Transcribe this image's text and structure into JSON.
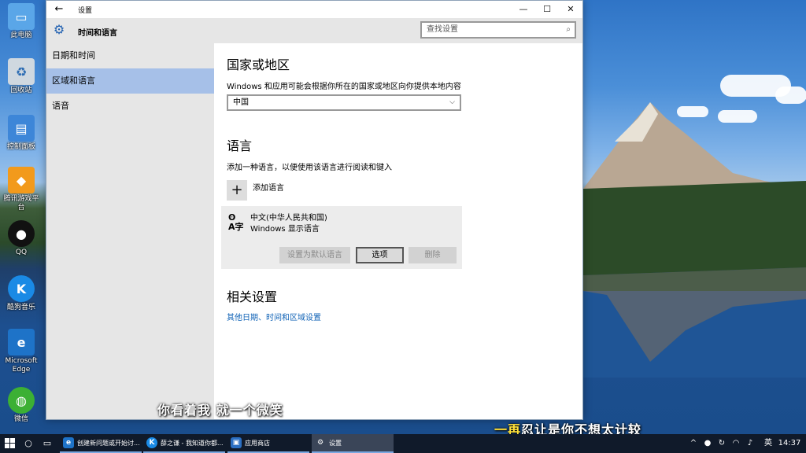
{
  "desktop": {
    "icons": [
      {
        "label": "此电脑",
        "icon": "computer-icon"
      },
      {
        "label": "回收站",
        "icon": "recycle-bin-icon"
      },
      {
        "label": "控制面板",
        "icon": "control-panel-icon"
      },
      {
        "label": "腾讯游戏平台",
        "icon": "tencent-games-icon"
      },
      {
        "label": "QQ",
        "icon": "qq-icon"
      },
      {
        "label": "酷狗音乐",
        "icon": "kugou-icon"
      },
      {
        "label": "Microsoft Edge",
        "icon": "edge-icon"
      },
      {
        "label": "微信",
        "icon": "wechat-icon"
      }
    ]
  },
  "window": {
    "title": "设置",
    "controls": {
      "minimize": "—",
      "maximize": "☐",
      "close": "✕"
    }
  },
  "sidebar": {
    "header": "时间和语言",
    "items": [
      {
        "label": "日期和时间",
        "selected": false
      },
      {
        "label": "区域和语言",
        "selected": true
      },
      {
        "label": "语音",
        "selected": false
      }
    ]
  },
  "search": {
    "placeholder": "查找设置"
  },
  "region": {
    "heading": "国家或地区",
    "description": "Windows 和应用可能会根据你所在的国家或地区向你提供本地内容",
    "selected_country": "中国"
  },
  "language": {
    "heading": "语言",
    "description": "添加一种语言，以便使用该语言进行阅读和键入",
    "add_label": "添加语言",
    "items": [
      {
        "name": "中文(中华人民共和国)",
        "subtitle": "Windows 显示语言",
        "buttons": {
          "set_default": "设置为默认语言",
          "options": "选项",
          "remove": "删除"
        }
      }
    ]
  },
  "related": {
    "heading": "相关设置",
    "link": "其他日期、时间和区域设置"
  },
  "subtitles": {
    "line1": "你看着我 就一个微笑",
    "line2": "一再忍让是你不想太计较"
  },
  "taskbar": {
    "tasks": [
      {
        "label": "创建新问题或开始讨...",
        "icon": "edge-icon",
        "active": false
      },
      {
        "label": "薛之谦 - 我知道你都...",
        "icon": "kugou-icon",
        "active": false
      },
      {
        "label": "应用商店",
        "icon": "store-icon",
        "active": false
      },
      {
        "label": "设置",
        "icon": "gear-icon",
        "active": true
      }
    ],
    "ime": "英",
    "time": "14:37"
  }
}
